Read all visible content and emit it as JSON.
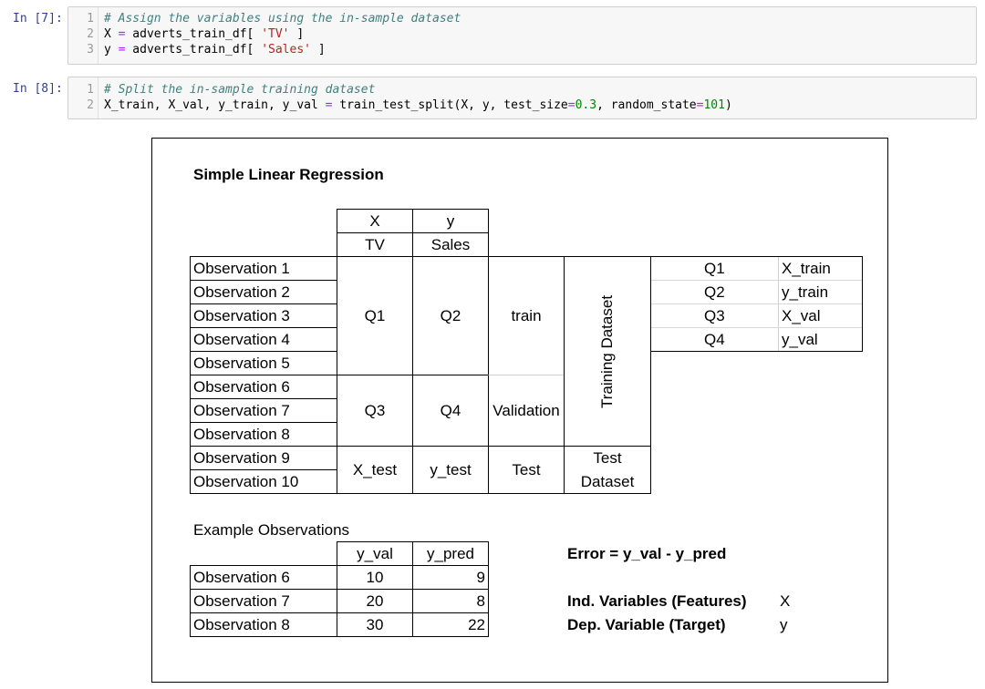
{
  "cells": [
    {
      "prompt": "In [7]:",
      "lines": [
        {
          "n": "1",
          "parts": [
            {
              "t": "# Assign the variables using the in-sample dataset",
              "c": "comment"
            }
          ]
        },
        {
          "n": "2",
          "parts": [
            {
              "t": "X ",
              "c": ""
            },
            {
              "t": "=",
              "c": "op"
            },
            {
              "t": " adverts_train_df[ ",
              "c": ""
            },
            {
              "t": "'TV'",
              "c": "str"
            },
            {
              "t": " ]",
              "c": ""
            }
          ]
        },
        {
          "n": "3",
          "parts": [
            {
              "t": "y ",
              "c": ""
            },
            {
              "t": "=",
              "c": "op"
            },
            {
              "t": " adverts_train_df[ ",
              "c": ""
            },
            {
              "t": "'Sales'",
              "c": "str"
            },
            {
              "t": " ]",
              "c": ""
            }
          ]
        }
      ]
    },
    {
      "prompt": "In [8]:",
      "lines": [
        {
          "n": "1",
          "parts": [
            {
              "t": "# Split the in-sample training dataset",
              "c": "comment"
            }
          ]
        },
        {
          "n": "2",
          "parts": [
            {
              "t": "X_train, X_val, y_train, y_val ",
              "c": ""
            },
            {
              "t": "=",
              "c": "op"
            },
            {
              "t": " train_test_split(X, y, test_size",
              "c": ""
            },
            {
              "t": "=",
              "c": "op"
            },
            {
              "t": "0.3",
              "c": "num"
            },
            {
              "t": ", random_state",
              "c": ""
            },
            {
              "t": "=",
              "c": "op"
            },
            {
              "t": "101",
              "c": "num"
            },
            {
              "t": ")",
              "c": ""
            }
          ]
        }
      ]
    }
  ],
  "diagram": {
    "title": "Simple Linear Regression",
    "col_var": [
      "X",
      "y"
    ],
    "col_name": [
      "TV",
      "Sales"
    ],
    "observations": [
      "Observation 1",
      "Observation 2",
      "Observation 3",
      "Observation 4",
      "Observation 5",
      "Observation 6",
      "Observation 7",
      "Observation 8",
      "Observation 9",
      "Observation 10"
    ],
    "q1": "Q1",
    "q2": "Q2",
    "q3": "Q3",
    "q4": "Q4",
    "train": "train",
    "validation": "Validation",
    "test": "Test",
    "x_test": "X_test",
    "y_test": "y_test",
    "training_dataset": "Training Dataset",
    "test_dataset_1": "Test",
    "test_dataset_2": "Dataset",
    "mapping": [
      {
        "q": "Q1",
        "v": "X_train"
      },
      {
        "q": "Q2",
        "v": "y_train"
      },
      {
        "q": "Q3",
        "v": "X_val"
      },
      {
        "q": "Q4",
        "v": "y_val"
      }
    ],
    "example_title": "Example Observations",
    "example_headers": [
      "y_val",
      "y_pred"
    ],
    "examples": [
      {
        "obs": "Observation 6",
        "y_val": "10",
        "y_pred": "9"
      },
      {
        "obs": "Observation 7",
        "y_val": "20",
        "y_pred": "8"
      },
      {
        "obs": "Observation 8",
        "y_val": "30",
        "y_pred": "22"
      }
    ],
    "error_formula": "Error = y_val - y_pred",
    "ind_label": "Ind. Variables (Features)",
    "ind_value": "X",
    "dep_label": "Dep. Variable (Target)",
    "dep_value": "y"
  }
}
